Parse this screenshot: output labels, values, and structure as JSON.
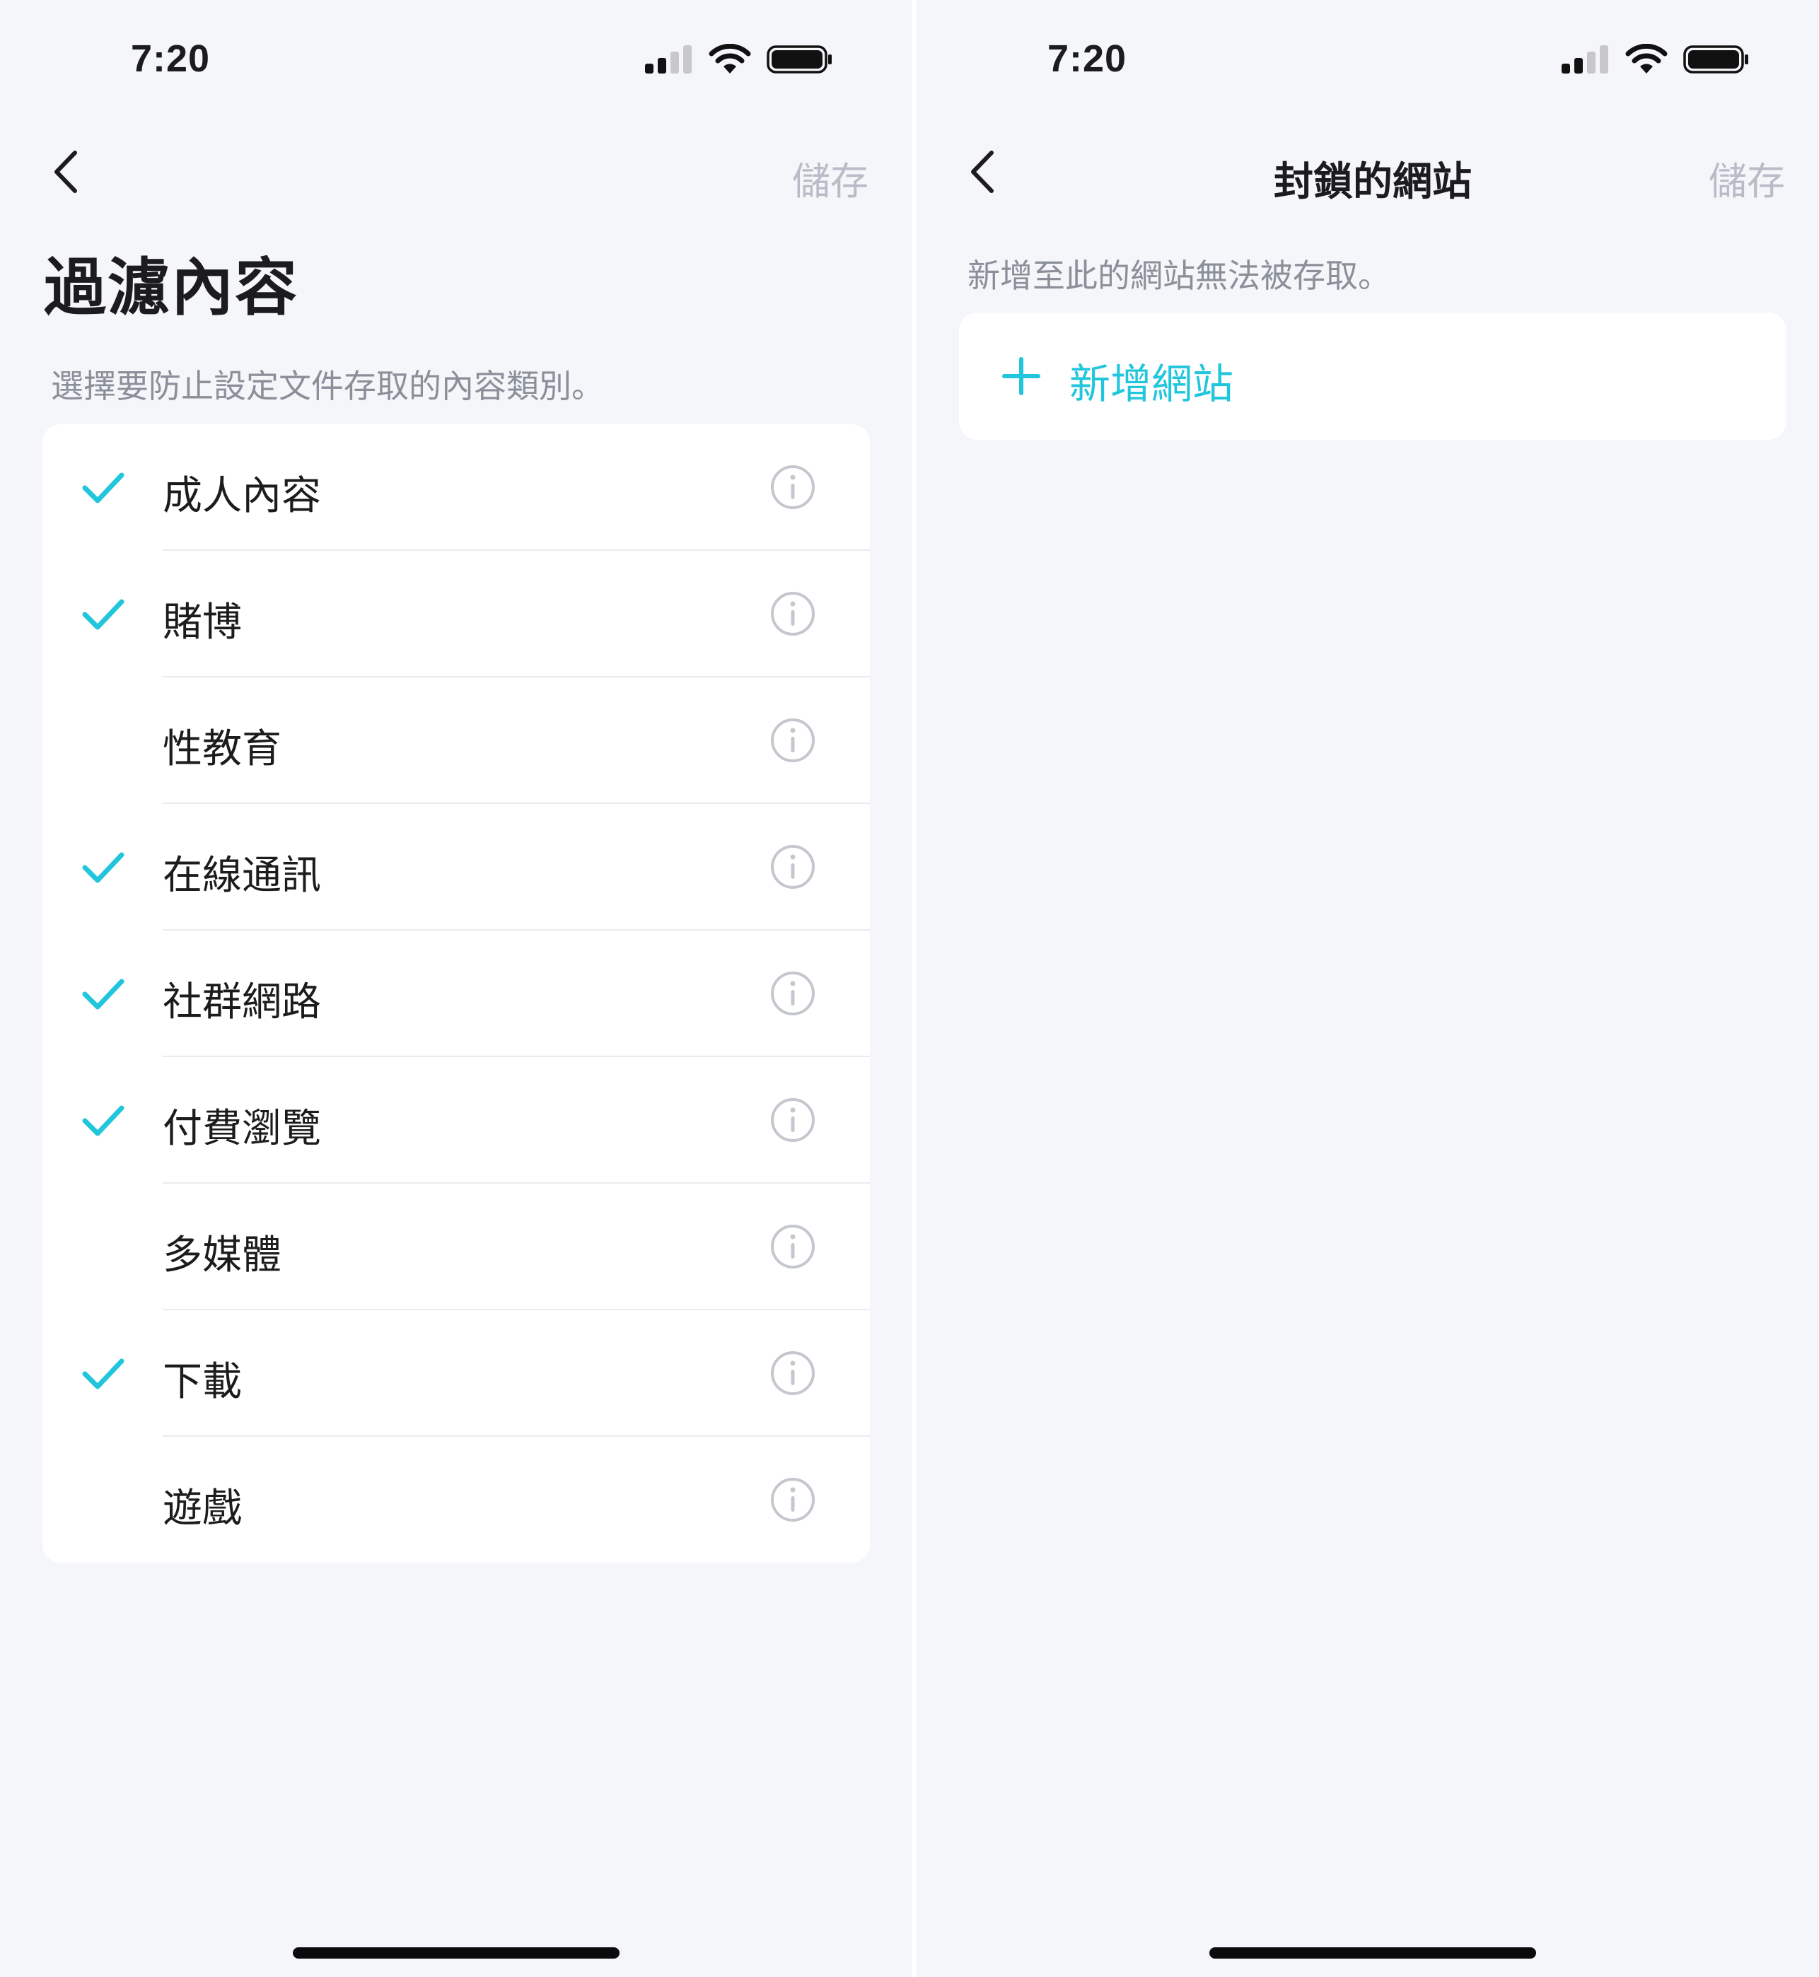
{
  "status": {
    "time": "7:20"
  },
  "colors": {
    "accent": "#22c6dc",
    "muted": "#b8bcc6",
    "background": "#f4f6fa"
  },
  "left": {
    "save_label": "儲存",
    "title": "過濾內容",
    "description": "選擇要防止設定文件存取的內容類別。",
    "items": [
      {
        "label": "成人內容",
        "checked": true
      },
      {
        "label": "賭博",
        "checked": true
      },
      {
        "label": "性教育",
        "checked": false
      },
      {
        "label": "在線通訊",
        "checked": true
      },
      {
        "label": "社群網路",
        "checked": true
      },
      {
        "label": "付費瀏覽",
        "checked": true
      },
      {
        "label": "多媒體",
        "checked": false
      },
      {
        "label": "下載",
        "checked": true
      },
      {
        "label": "遊戲",
        "checked": false
      }
    ]
  },
  "right": {
    "title": "封鎖的網站",
    "save_label": "儲存",
    "description": "新增至此的網站無法被存取。",
    "add_label": "新增網站"
  },
  "icons": {
    "back": "chevron-left-icon",
    "check": "checkmark-icon",
    "info": "info-circle-icon",
    "plus": "plus-icon",
    "signal": "cellular-signal-icon",
    "wifi": "wifi-icon",
    "battery": "battery-icon"
  }
}
